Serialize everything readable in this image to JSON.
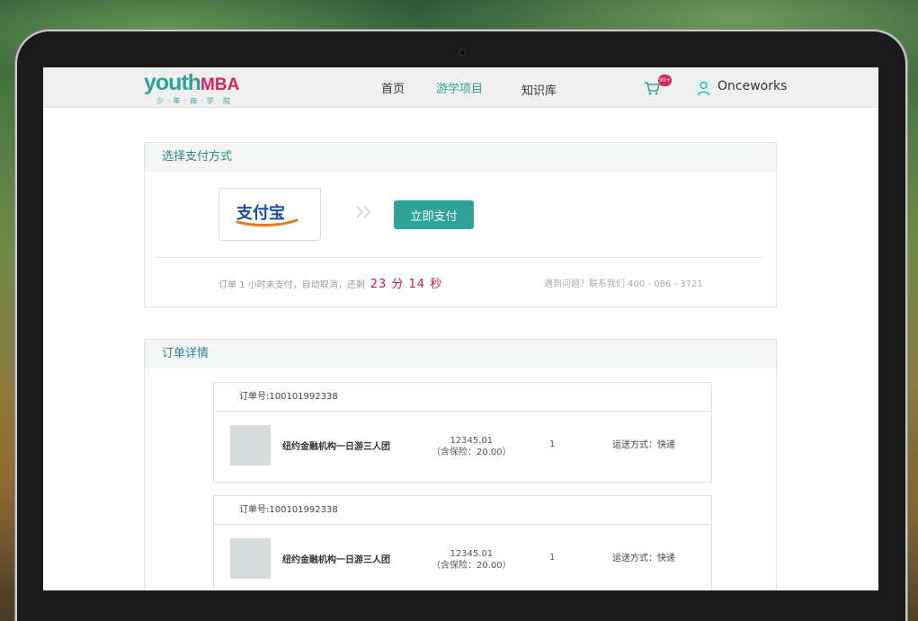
{
  "header": {
    "logo_main": "youth",
    "logo_accent": "MBA",
    "logo_sub": "少·年·商·学·院",
    "nav": [
      {
        "label": "首页"
      },
      {
        "label": "游学项目"
      },
      {
        "label": "知识库"
      }
    ],
    "cart_badge": "99+",
    "username": "Onceworks"
  },
  "payment": {
    "title": "选择支付方式",
    "method_name": "支付宝",
    "pay_button": "立即支付",
    "countdown_text": "订单 1 小时未支付，自动取消，还剩",
    "countdown_time": "23 分 14 秒",
    "contact": "遇到问题？联系我们 400 - 086 - 3721"
  },
  "details": {
    "title": "订单详情",
    "orders": [
      {
        "order_no": "订单号:100101992338",
        "product": "纽约金融机构一日游三人团",
        "price": "12345.01",
        "insurance": "（含保险：20.00）",
        "qty": "1",
        "shipping": "运送方式：快递"
      },
      {
        "order_no": "订单号:100101992338",
        "product": "纽约金融机构一日游三人团",
        "price": "12345.01",
        "insurance": "（含保险：20.00）",
        "qty": "1",
        "shipping": "运送方式：快递"
      }
    ]
  },
  "colors": {
    "accent": "#2fa39a",
    "brand_pink": "#d9245f",
    "countdown": "#c2185b"
  }
}
